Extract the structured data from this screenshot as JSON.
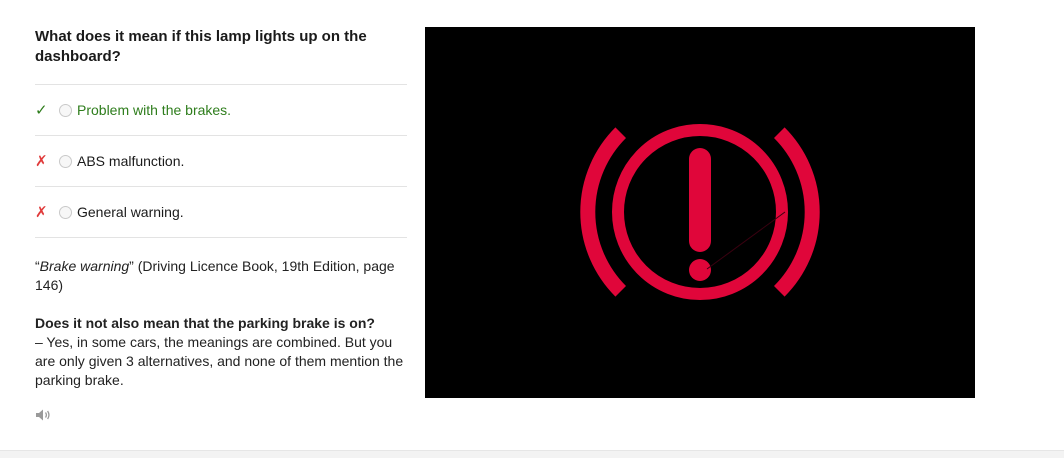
{
  "question": "What does it mean if this lamp lights up on the dashboard?",
  "answers": [
    {
      "mark": "✓",
      "label": "Problem with the brakes.",
      "status": "correct"
    },
    {
      "mark": "✗",
      "label": "ABS malfunction.",
      "status": "wrong"
    },
    {
      "mark": "✗",
      "label": "General warning.",
      "status": "wrong"
    }
  ],
  "source": {
    "open_quote": "“",
    "title": "Brake warning",
    "close_quote": "”",
    "reference": " (Driving Licence Book, 19th Edition, page 146)"
  },
  "faq": {
    "question": "Does it not also mean that the parking brake is on?",
    "answer": "– Yes, in some cars, the meanings are combined. But you are only given 3 alternatives, and none of them mention the parking brake."
  },
  "icons": {
    "speaker": "speaker-icon",
    "lamp": "brake-warning-lamp-icon"
  },
  "colors": {
    "correct": "#2e7d1c",
    "wrong": "#e03b3b",
    "lamp": "#e0063a",
    "panel_bg": "#000000"
  }
}
